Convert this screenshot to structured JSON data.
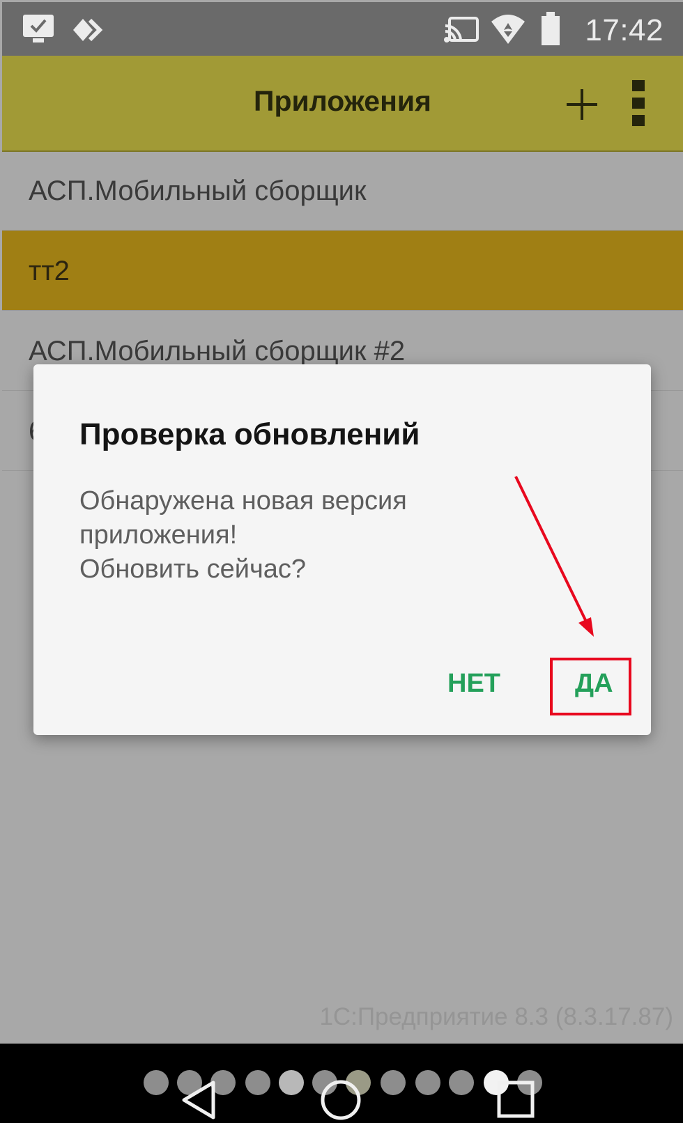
{
  "status_bar": {
    "time": "17:42",
    "icons": [
      "monitor-check-icon",
      "code-arrows-icon",
      "cast-icon",
      "wifi-icon",
      "battery-icon"
    ]
  },
  "toolbar": {
    "title": "Приложения",
    "add_icon": "plus-icon",
    "menu_icon": "more-vert-icon"
  },
  "app_list": {
    "items": [
      {
        "label": "АСП.Мобильный сборщик",
        "selected": false
      },
      {
        "label": "тт2",
        "selected": true
      },
      {
        "label": "АСП.Мобильный сборщик #2",
        "selected": false
      },
      {
        "label": "6",
        "selected": false
      }
    ]
  },
  "dialog": {
    "title": "Проверка обновлений",
    "message_lines": [
      "Обнаружена новая версия",
      "приложения!",
      "Обновить сейчас?"
    ],
    "no_label": "НЕТ",
    "yes_label": "ДА"
  },
  "footer": {
    "version": "1С:Предприятие 8.3 (8.3.17.87)"
  },
  "nav_bar": {
    "icons": [
      "back-icon",
      "home-icon",
      "recents-icon"
    ]
  },
  "colors": {
    "toolbar": "#a19a36",
    "selected_row": "#a07f14",
    "dialog_button": "#24a05a",
    "annotation": "#e8081e"
  }
}
